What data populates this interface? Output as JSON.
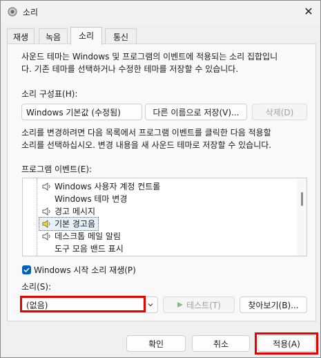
{
  "window": {
    "title": "소리",
    "close": "✕"
  },
  "tabs": [
    {
      "label": "재생"
    },
    {
      "label": "녹음"
    },
    {
      "label": "소리"
    },
    {
      "label": "통신"
    }
  ],
  "panel": {
    "description": [
      "사운드 테마는 Windows 및 프로그램의 이벤트에 적용되는 소리 집합입니",
      "다. 기존 테마를 선택하거나 수정한 테마를 저장할 수 있습니다."
    ],
    "scheme_label": "소리 구성표(H):",
    "scheme_value": "Windows 기본값 (수정됨)",
    "save_as_label": "다른 이름으로 저장(V)...",
    "delete_label": "삭제(D)",
    "instructions": [
      "소리를 변경하려면 다음 목록에서 프로그램 이벤트를 클릭한 다음 적용할",
      "소리를 선택하십시오. 변경 내용을 새 사운드 테마로 저장할 수 있습니다."
    ],
    "events_label": "프로그램 이벤트(E):",
    "events": [
      {
        "label": "Windows 사용자 계정 컨트롤",
        "has_sound": true,
        "selected": false
      },
      {
        "label": "Windows 테마 변경",
        "has_sound": false,
        "selected": false
      },
      {
        "label": "경고 메시지",
        "has_sound": true,
        "selected": false
      },
      {
        "label": "기본 경고음",
        "has_sound": true,
        "selected": true
      },
      {
        "label": "데스크톱 메일 알림",
        "has_sound": true,
        "selected": false
      },
      {
        "label": "도구 모음 밴드 표시",
        "has_sound": false,
        "selected": false
      }
    ],
    "startup_sound_label": "Windows 시작 소리 재생(P)",
    "startup_sound_checked": true,
    "sound_label": "소리(S):",
    "sound_value": "(없음)",
    "test_label": "테스트(T)",
    "browse_label": "찾아보기(B)..."
  },
  "footer": {
    "ok_label": "확인",
    "cancel_label": "취소",
    "apply_label": "적용(A)"
  },
  "colors": {
    "accent": "#005fb8",
    "highlight": "#e60000",
    "selection": "#e5f1fb"
  }
}
